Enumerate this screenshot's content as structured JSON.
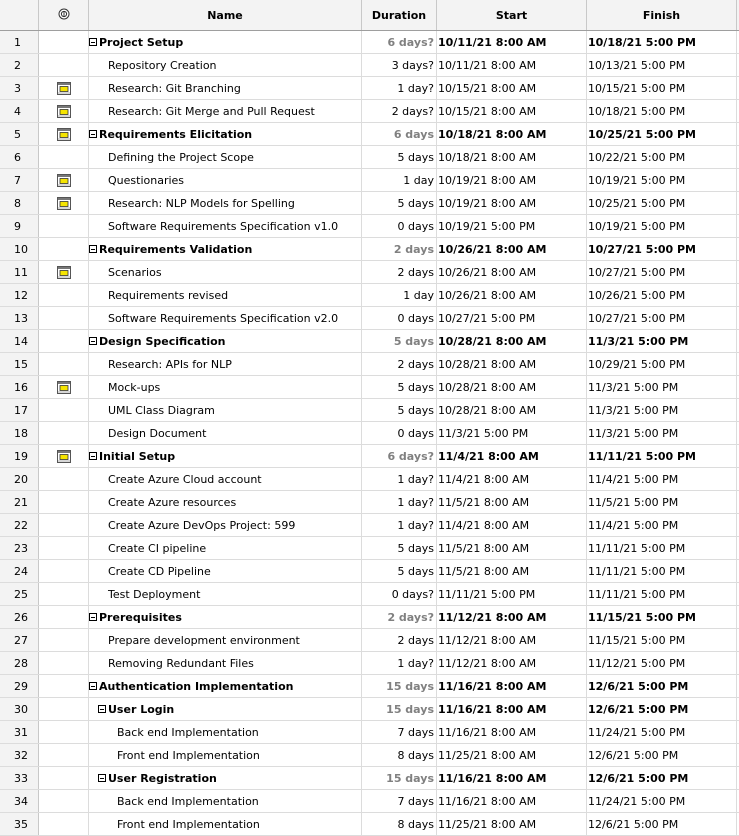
{
  "columns": {
    "indicator_icon": "info-icon",
    "name": "Name",
    "duration": "Duration",
    "start": "Start",
    "finish": "Finish"
  },
  "rows": [
    {
      "id": "1",
      "name": "Project Setup",
      "duration": "6 days?",
      "start": "10/11/21 8:00 AM",
      "finish": "10/18/21 5:00 PM",
      "summary": true,
      "level": 0,
      "icon": false
    },
    {
      "id": "2",
      "name": "Repository Creation",
      "duration": "3 days?",
      "start": "10/11/21 8:00 AM",
      "finish": "10/13/21 5:00 PM",
      "summary": false,
      "level": 1,
      "icon": false
    },
    {
      "id": "3",
      "name": "Research: Git Branching",
      "duration": "1 day?",
      "start": "10/15/21 8:00 AM",
      "finish": "10/15/21 5:00 PM",
      "summary": false,
      "level": 1,
      "icon": true
    },
    {
      "id": "4",
      "name": "Research: Git Merge and Pull Request",
      "duration": "2 days?",
      "start": "10/15/21 8:00 AM",
      "finish": "10/18/21 5:00 PM",
      "summary": false,
      "level": 1,
      "icon": true
    },
    {
      "id": "5",
      "name": "Requirements Elicitation",
      "duration": "6 days",
      "start": "10/18/21 8:00 AM",
      "finish": "10/25/21 5:00 PM",
      "summary": true,
      "level": 0,
      "icon": true
    },
    {
      "id": "6",
      "name": "Defining the Project Scope",
      "duration": "5 days",
      "start": "10/18/21 8:00 AM",
      "finish": "10/22/21 5:00 PM",
      "summary": false,
      "level": 1,
      "icon": false
    },
    {
      "id": "7",
      "name": "Questionaries",
      "duration": "1 day",
      "start": "10/19/21 8:00 AM",
      "finish": "10/19/21 5:00 PM",
      "summary": false,
      "level": 1,
      "icon": true
    },
    {
      "id": "8",
      "name": "Research: NLP Models for Spelling",
      "duration": "5 days",
      "start": "10/19/21 8:00 AM",
      "finish": "10/25/21 5:00 PM",
      "summary": false,
      "level": 1,
      "icon": true
    },
    {
      "id": "9",
      "name": "Software Requirements Specification v1.0",
      "duration": "0 days",
      "start": "10/19/21 5:00 PM",
      "finish": "10/19/21 5:00 PM",
      "summary": false,
      "level": 1,
      "icon": false
    },
    {
      "id": "10",
      "name": "Requirements Validation",
      "duration": "2 days",
      "start": "10/26/21 8:00 AM",
      "finish": "10/27/21 5:00 PM",
      "summary": true,
      "level": 0,
      "icon": false
    },
    {
      "id": "11",
      "name": "Scenarios",
      "duration": "2 days",
      "start": "10/26/21 8:00 AM",
      "finish": "10/27/21 5:00 PM",
      "summary": false,
      "level": 1,
      "icon": true
    },
    {
      "id": "12",
      "name": "Requirements revised",
      "duration": "1 day",
      "start": "10/26/21 8:00 AM",
      "finish": "10/26/21 5:00 PM",
      "summary": false,
      "level": 1,
      "icon": false
    },
    {
      "id": "13",
      "name": "Software Requirements Specification v2.0",
      "duration": "0 days",
      "start": "10/27/21 5:00 PM",
      "finish": "10/27/21 5:00 PM",
      "summary": false,
      "level": 1,
      "icon": false
    },
    {
      "id": "14",
      "name": "Design Specification",
      "duration": "5 days",
      "start": "10/28/21 8:00 AM",
      "finish": "11/3/21 5:00 PM",
      "summary": true,
      "level": 0,
      "icon": false
    },
    {
      "id": "15",
      "name": "Research: APIs for NLP",
      "duration": "2 days",
      "start": "10/28/21 8:00 AM",
      "finish": "10/29/21 5:00 PM",
      "summary": false,
      "level": 1,
      "icon": false
    },
    {
      "id": "16",
      "name": "Mock-ups",
      "duration": "5 days",
      "start": "10/28/21 8:00 AM",
      "finish": "11/3/21 5:00 PM",
      "summary": false,
      "level": 1,
      "icon": true
    },
    {
      "id": "17",
      "name": "UML Class Diagram",
      "duration": "5 days",
      "start": "10/28/21 8:00 AM",
      "finish": "11/3/21 5:00 PM",
      "summary": false,
      "level": 1,
      "icon": false
    },
    {
      "id": "18",
      "name": "Design Document",
      "duration": "0 days",
      "start": "11/3/21 5:00 PM",
      "finish": "11/3/21 5:00 PM",
      "summary": false,
      "level": 1,
      "icon": false
    },
    {
      "id": "19",
      "name": "Initial Setup",
      "duration": "6 days?",
      "start": "11/4/21 8:00 AM",
      "finish": "11/11/21 5:00 PM",
      "summary": true,
      "level": 0,
      "icon": true
    },
    {
      "id": "20",
      "name": "Create Azure Cloud account",
      "duration": "1 day?",
      "start": "11/4/21 8:00 AM",
      "finish": "11/4/21 5:00 PM",
      "summary": false,
      "level": 1,
      "icon": false
    },
    {
      "id": "21",
      "name": "Create Azure resources",
      "duration": "1 day?",
      "start": "11/5/21 8:00 AM",
      "finish": "11/5/21 5:00 PM",
      "summary": false,
      "level": 1,
      "icon": false
    },
    {
      "id": "22",
      "name": "Create Azure DevOps Project: 599",
      "duration": "1 day?",
      "start": "11/4/21 8:00 AM",
      "finish": "11/4/21 5:00 PM",
      "summary": false,
      "level": 1,
      "icon": false
    },
    {
      "id": "23",
      "name": "Create CI pipeline",
      "duration": "5 days",
      "start": "11/5/21 8:00 AM",
      "finish": "11/11/21 5:00 PM",
      "summary": false,
      "level": 1,
      "icon": false
    },
    {
      "id": "24",
      "name": "Create CD Pipeline",
      "duration": "5 days",
      "start": "11/5/21 8:00 AM",
      "finish": "11/11/21 5:00 PM",
      "summary": false,
      "level": 1,
      "icon": false
    },
    {
      "id": "25",
      "name": "Test Deployment",
      "duration": "0 days?",
      "start": "11/11/21 5:00 PM",
      "finish": "11/11/21 5:00 PM",
      "summary": false,
      "level": 1,
      "icon": false
    },
    {
      "id": "26",
      "name": "Prerequisites",
      "duration": "2 days?",
      "start": "11/12/21 8:00 AM",
      "finish": "11/15/21 5:00 PM",
      "summary": true,
      "level": 0,
      "icon": false
    },
    {
      "id": "27",
      "name": "Prepare development environment",
      "duration": "2 days",
      "start": "11/12/21 8:00 AM",
      "finish": "11/15/21 5:00 PM",
      "summary": false,
      "level": 1,
      "icon": false
    },
    {
      "id": "28",
      "name": "Removing Redundant Files",
      "duration": "1 day?",
      "start": "11/12/21 8:00 AM",
      "finish": "11/12/21 5:00 PM",
      "summary": false,
      "level": 1,
      "icon": false
    },
    {
      "id": "29",
      "name": "Authentication Implementation",
      "duration": "15 days",
      "start": "11/16/21 8:00 AM",
      "finish": "12/6/21 5:00 PM",
      "summary": true,
      "level": 0,
      "icon": false
    },
    {
      "id": "30",
      "name": "User Login",
      "duration": "15 days",
      "start": "11/16/21 8:00 AM",
      "finish": "12/6/21 5:00 PM",
      "summary": true,
      "level": 1,
      "icon": false
    },
    {
      "id": "31",
      "name": "Back end Implementation",
      "duration": "7 days",
      "start": "11/16/21 8:00 AM",
      "finish": "11/24/21 5:00 PM",
      "summary": false,
      "level": 2,
      "icon": false
    },
    {
      "id": "32",
      "name": "Front end Implementation",
      "duration": "8 days",
      "start": "11/25/21 8:00 AM",
      "finish": "12/6/21 5:00 PM",
      "summary": false,
      "level": 2,
      "icon": false
    },
    {
      "id": "33",
      "name": "User Registration",
      "duration": "15 days",
      "start": "11/16/21 8:00 AM",
      "finish": "12/6/21 5:00 PM",
      "summary": true,
      "level": 1,
      "icon": false
    },
    {
      "id": "34",
      "name": "Back end Implementation",
      "duration": "7 days",
      "start": "11/16/21 8:00 AM",
      "finish": "11/24/21 5:00 PM",
      "summary": false,
      "level": 2,
      "icon": false
    },
    {
      "id": "35",
      "name": "Front end Implementation",
      "duration": "8 days",
      "start": "11/25/21 8:00 AM",
      "finish": "12/6/21 5:00 PM",
      "summary": false,
      "level": 2,
      "icon": false
    }
  ]
}
